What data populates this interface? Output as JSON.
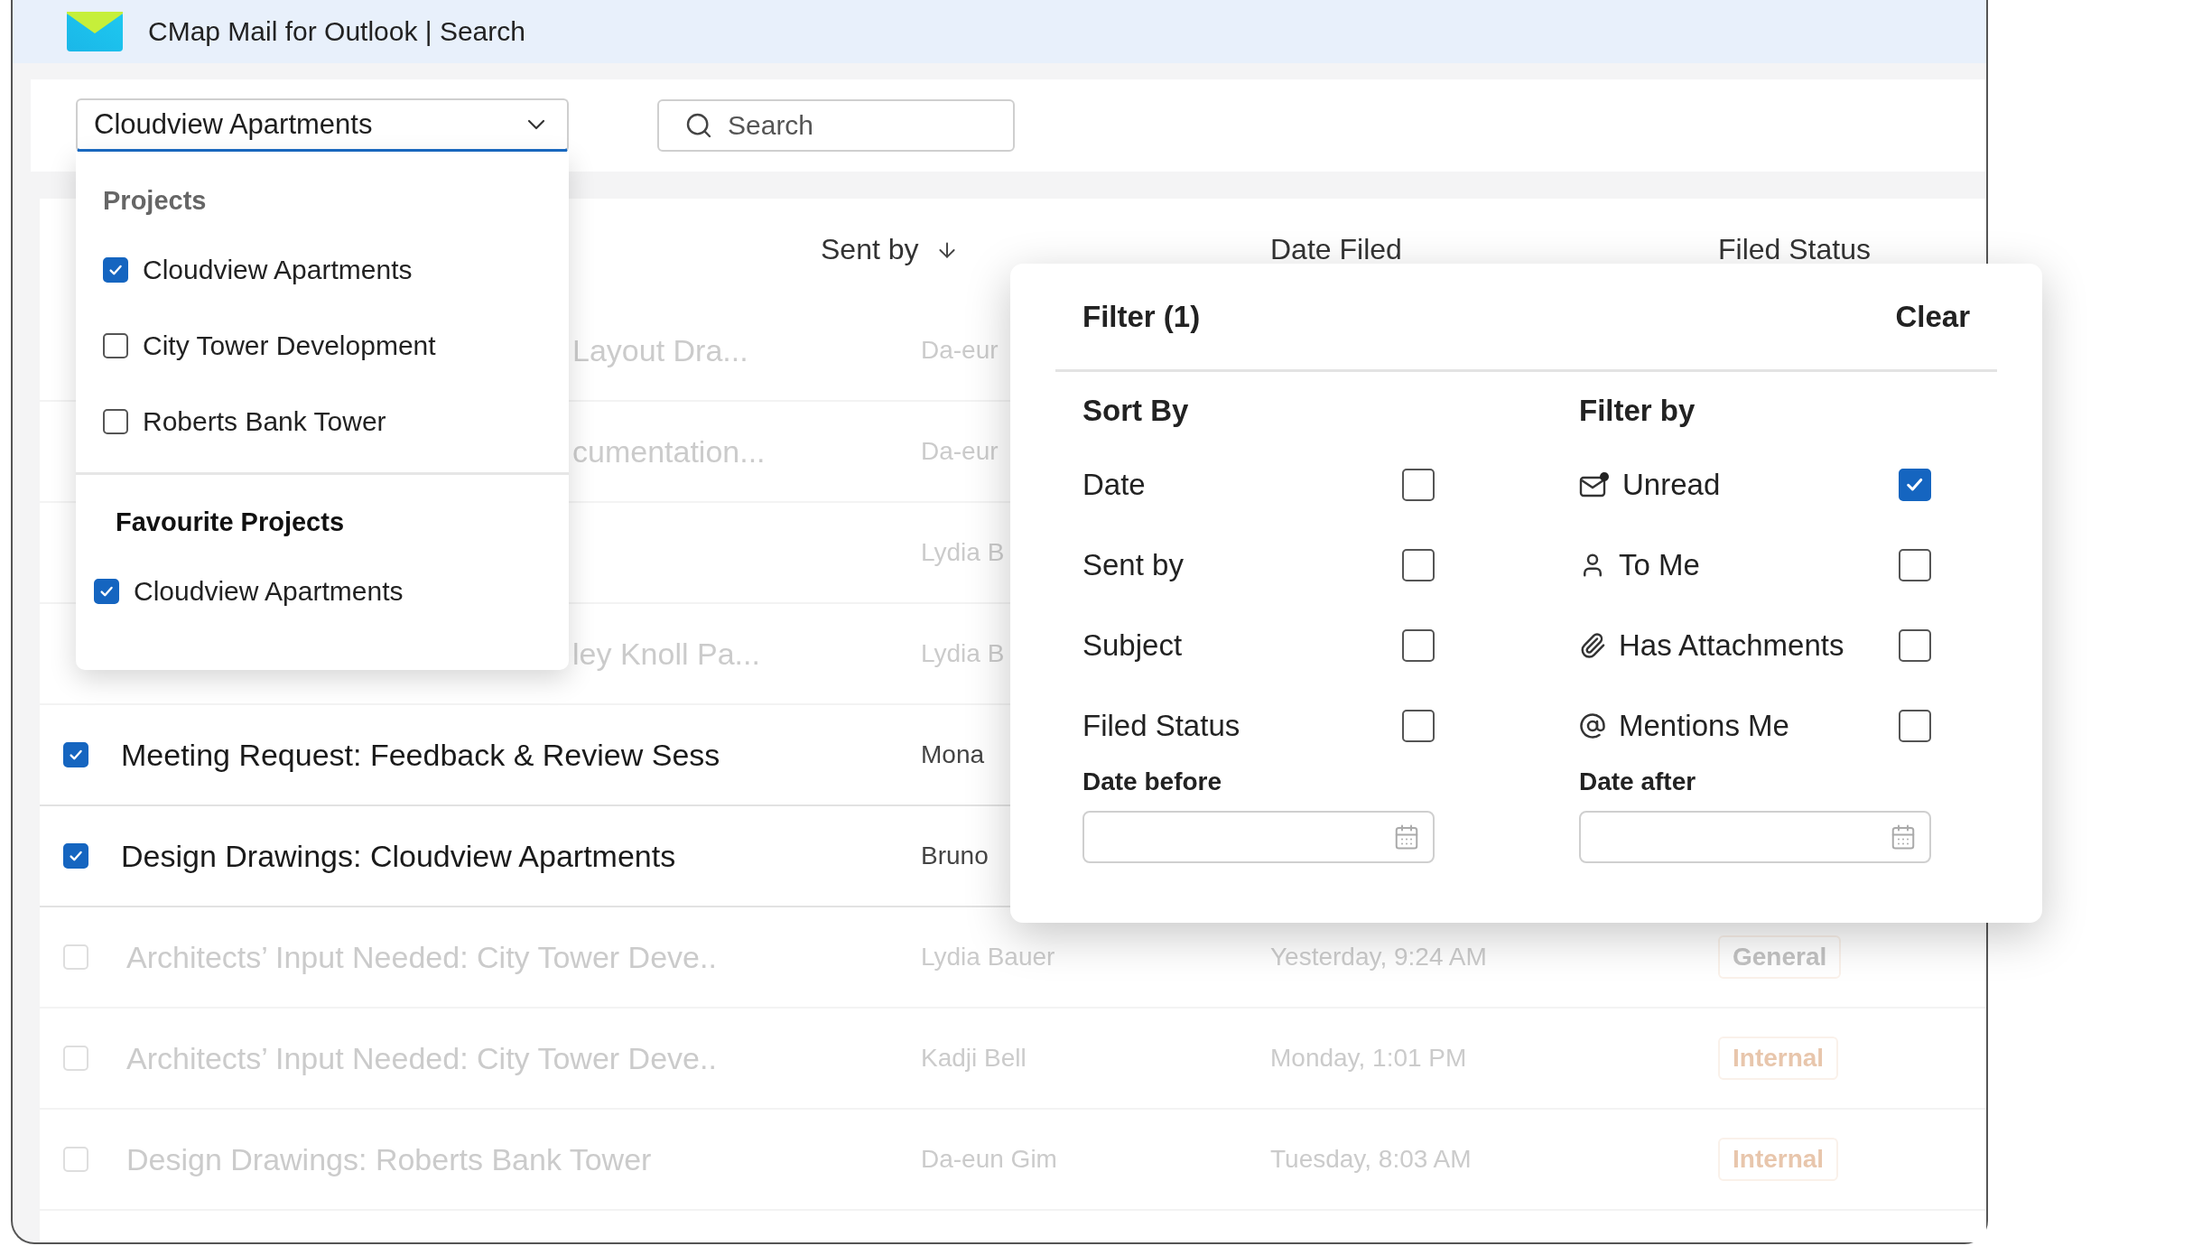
{
  "window": {
    "title": "CMap Mail for Outlook | Search"
  },
  "project_select": {
    "value": "Cloudview Apartments",
    "expanded": true
  },
  "search": {
    "placeholder": "Search"
  },
  "project_menu": {
    "sections": [
      {
        "heading": "Projects",
        "kind": "muted",
        "items": [
          {
            "label": "Cloudview Apartments",
            "checked": true
          },
          {
            "label": "City Tower Development",
            "checked": false
          },
          {
            "label": "Roberts Bank Tower",
            "checked": false
          }
        ]
      },
      {
        "heading": "Favourite Projects",
        "kind": "bold",
        "items": [
          {
            "label": "Cloudview Apartments",
            "checked": true
          }
        ]
      }
    ]
  },
  "table": {
    "columns": [
      {
        "label": "Sent by",
        "sorted": true
      },
      {
        "label": "Date Filed",
        "sorted": false
      },
      {
        "label": "Filed Status",
        "sorted": false
      }
    ],
    "rows": [
      {
        "title": "Layout Dra...",
        "sender": "Da-eur",
        "selected": false,
        "covered": true
      },
      {
        "title": "cumentation...",
        "sender": "Da-eur",
        "selected": false,
        "covered": true
      },
      {
        "sender": "Lydia B",
        "selected": false,
        "covered": true
      },
      {
        "title": "ley Knoll Pa...",
        "sender": "Lydia B",
        "selected": false,
        "covered": true
      },
      {
        "title": "Meeting Request: Feedback & Review Sess",
        "sender": "Mona",
        "selected": true,
        "covered": false
      },
      {
        "title": "Design Drawings: Cloudview Apartments",
        "sender": "Bruno",
        "selected": true,
        "covered": false
      },
      {
        "title": "Architects’ Input Needed: City Tower Deve..",
        "sender": "Lydia Bauer",
        "date": "Yesterday, 9:24 AM",
        "status": {
          "label": "General",
          "color": "#c2c2c2"
        },
        "selected": false,
        "covered": false
      },
      {
        "title": "Architects’ Input Needed: City Tower Deve..",
        "sender": "Kadji Bell",
        "date": "Monday, 1:01 PM",
        "status": {
          "label": "Internal",
          "color": "#e8c6ac"
        },
        "selected": false,
        "covered": false
      },
      {
        "title": "Design Drawings: Roberts Bank Tower",
        "sender": "Da-eun Gim",
        "date": "Tuesday, 8:03 AM",
        "status": {
          "label": "Internal",
          "color": "#e8c6ac"
        },
        "selected": false,
        "covered": false
      }
    ]
  },
  "filter_panel": {
    "title": "Filter (1)",
    "clear": "Clear",
    "sort": {
      "heading": "Sort By",
      "options": [
        {
          "label": "Date",
          "checked": false
        },
        {
          "label": "Sent by",
          "checked": false
        },
        {
          "label": "Subject",
          "checked": false
        },
        {
          "label": "Filed Status",
          "checked": false
        }
      ]
    },
    "filter": {
      "heading": "Filter by",
      "options": [
        {
          "label": "Unread",
          "checked": true
        },
        {
          "label": "To Me",
          "checked": false
        },
        {
          "label": "Has Attachments",
          "checked": false
        },
        {
          "label": "Mentions Me",
          "checked": false
        }
      ]
    },
    "date_fields": [
      {
        "label": "Date before"
      },
      {
        "label": "Date after"
      }
    ]
  }
}
